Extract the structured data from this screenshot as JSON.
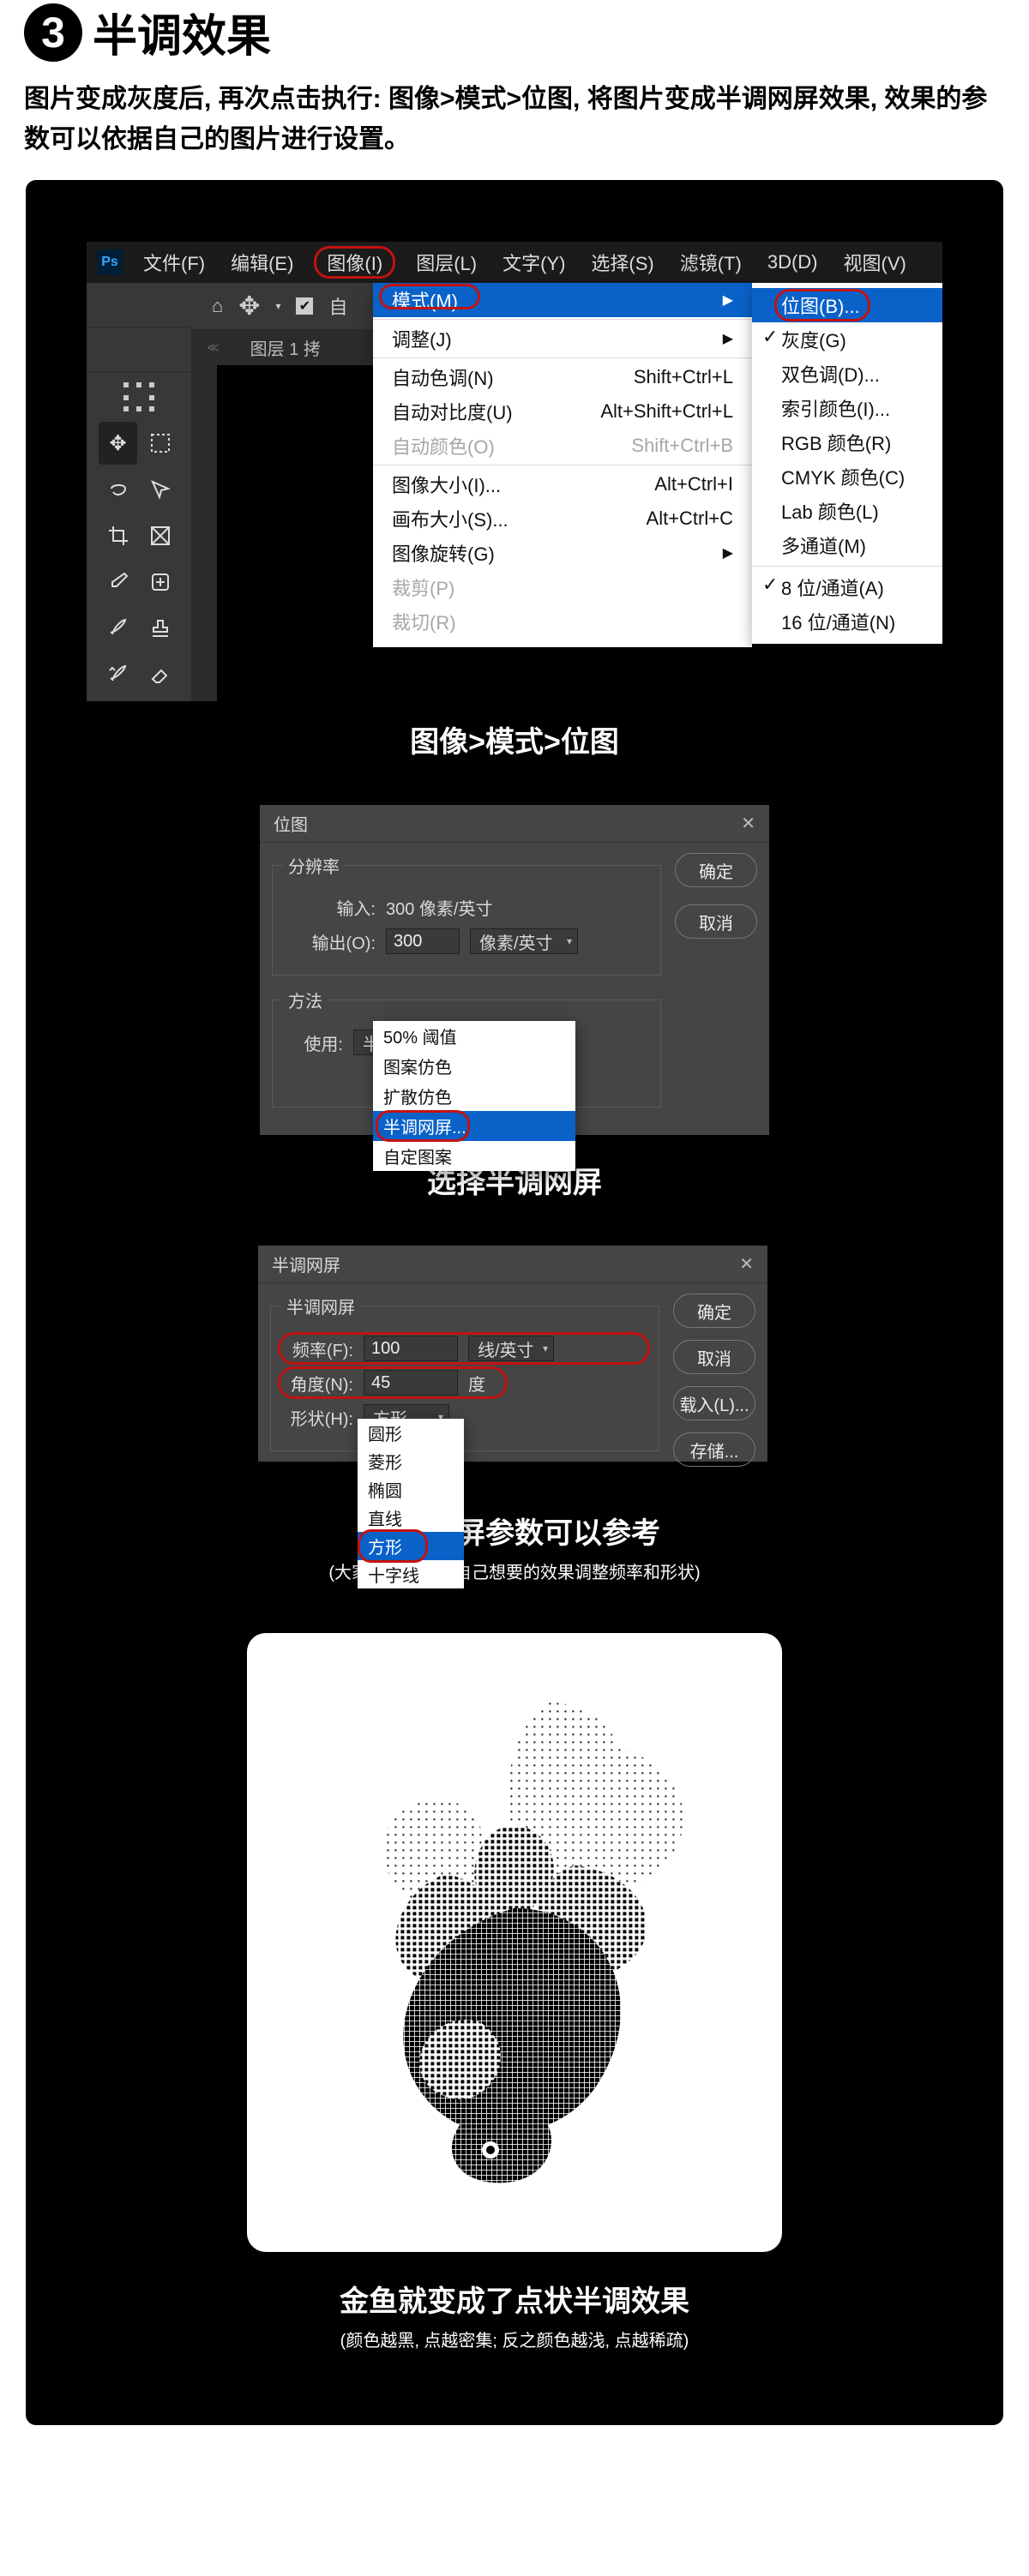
{
  "header": {
    "step_number": "3",
    "title": "半调效果",
    "intro": "图片变成灰度后, 再次点击执行: 图像>模式>位图, 将图片变成半调网屏效果, 效果的参数可以依据自己的图片进行设置。"
  },
  "panel1": {
    "ps_logo": "Ps",
    "menu": {
      "file": "文件(F)",
      "edit": "编辑(E)",
      "image": "图像(I)",
      "layer": "图层(L)",
      "type": "文字(Y)",
      "select": "选择(S)",
      "filter": "滤镜(T)",
      "threeD": "3D(D)",
      "view": "视图(V)"
    },
    "optbar": {
      "auto_select_label": "自"
    },
    "tab_label": "图层 1 拷",
    "dropdown": {
      "mode": "模式(M)",
      "adjust": "调整(J)",
      "autoTone": {
        "l": "自动色调(N)",
        "s": "Shift+Ctrl+L"
      },
      "autoContrast": {
        "l": "自动对比度(U)",
        "s": "Alt+Shift+Ctrl+L"
      },
      "autoColor": {
        "l": "自动颜色(O)",
        "s": "Shift+Ctrl+B"
      },
      "imgSize": {
        "l": "图像大小(I)...",
        "s": "Alt+Ctrl+I"
      },
      "canvasSize": {
        "l": "画布大小(S)...",
        "s": "Alt+Ctrl+C"
      },
      "rotate": "图像旋转(G)",
      "crop": "裁剪(P)",
      "trim": "裁切(R)"
    },
    "submenu": {
      "bitmap": "位图(B)...",
      "gray": "灰度(G)",
      "duotone": "双色调(D)...",
      "indexed": "索引颜色(I)...",
      "rgb": "RGB 颜色(R)",
      "cmyk": "CMYK 颜色(C)",
      "lab": "Lab 颜色(L)",
      "multi": "多通道(M)",
      "bit8": "8 位/通道(A)",
      "bit16": "16 位/通道(N)"
    },
    "caption": "图像>模式>位图"
  },
  "panel2": {
    "title": "位图",
    "ok": "确定",
    "cancel": "取消",
    "reso_legend": "分辨率",
    "input_k": "输入:",
    "input_v": "300 像素/英寸",
    "output_k": "输出(O):",
    "output_v": "300",
    "output_unit": "像素/英寸",
    "method_legend": "方法",
    "use_k": "使用:",
    "use_v": "半调网屏...",
    "options": [
      "50% 阈值",
      "图案仿色",
      "扩散仿色",
      "半调网屏...",
      "自定图案"
    ],
    "caption": "选择半调网屏"
  },
  "panel3": {
    "title": "半调网屏",
    "grp": "半调网屏",
    "freq_k": "频率(F):",
    "freq_v": "100",
    "freq_unit": "线/英寸",
    "angle_k": "角度(N):",
    "angle_v": "45",
    "angle_unit": "度",
    "shape_k": "形状(H):",
    "shape_v": "方形",
    "ok": "确定",
    "cancel": "取消",
    "load": "载入(L)...",
    "save": "存储...",
    "shapes": [
      "圆形",
      "菱形",
      "椭圆",
      "直线",
      "方形",
      "十字线"
    ],
    "caption": "半调网屏参数可以参考",
    "sub": "(大家也可以根据自己想要的效果调整频率和形状)"
  },
  "panel4": {
    "caption": "金鱼就变成了点状半调效果",
    "sub": "(颜色越黑, 点越密集; 反之颜色越浅, 点越稀疏)"
  }
}
